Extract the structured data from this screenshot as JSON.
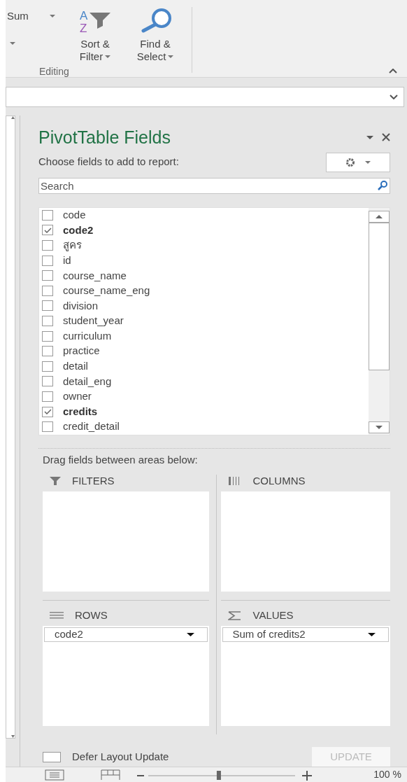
{
  "ribbon": {
    "cut_label": "Sum",
    "buttons": [
      {
        "kind": "sort",
        "icon_letters": [
          "A",
          "Z"
        ],
        "lines": [
          "Sort &",
          "Filter"
        ]
      },
      {
        "kind": "find",
        "lines": [
          "Find &",
          "Select"
        ]
      }
    ],
    "group": "Editing"
  },
  "pivot_pane": {
    "title": "PivotTable Fields",
    "instruction": "Choose fields to add to report:",
    "search": {
      "placeholder": "Search"
    },
    "fields": [
      {
        "label": "code",
        "checked": false
      },
      {
        "label": "code2",
        "checked": true
      },
      {
        "label": "สูคร",
        "checked": false
      },
      {
        "label": "id",
        "checked": false
      },
      {
        "label": "course_name",
        "checked": false
      },
      {
        "label": "course_name_eng",
        "checked": false
      },
      {
        "label": "division",
        "checked": false
      },
      {
        "label": "student_year",
        "checked": false
      },
      {
        "label": "curriculum",
        "checked": false
      },
      {
        "label": "practice",
        "checked": false
      },
      {
        "label": "detail",
        "checked": false
      },
      {
        "label": "detail_eng",
        "checked": false
      },
      {
        "label": "owner",
        "checked": false
      },
      {
        "label": "credits",
        "checked": true
      },
      {
        "label": "credit_detail",
        "checked": false
      }
    ],
    "areas_hint": "Drag fields between areas below:",
    "areas": [
      {
        "kind": "filters",
        "label": "FILTERS"
      },
      {
        "kind": "columns",
        "label": "COLUMNS"
      },
      {
        "kind": "rows",
        "label": "ROWS",
        "items": [
          "code2"
        ]
      },
      {
        "kind": "values",
        "label": "VALUES",
        "items": [
          "Sum of credits2"
        ]
      }
    ],
    "defer": {
      "label": "Defer Layout Update",
      "checked": false
    },
    "update_button": {
      "label": "UPDATE",
      "disabled": true
    }
  },
  "status_bar": {
    "zoom_slider": {
      "level": 0.48
    },
    "zoom": "100 %"
  }
}
